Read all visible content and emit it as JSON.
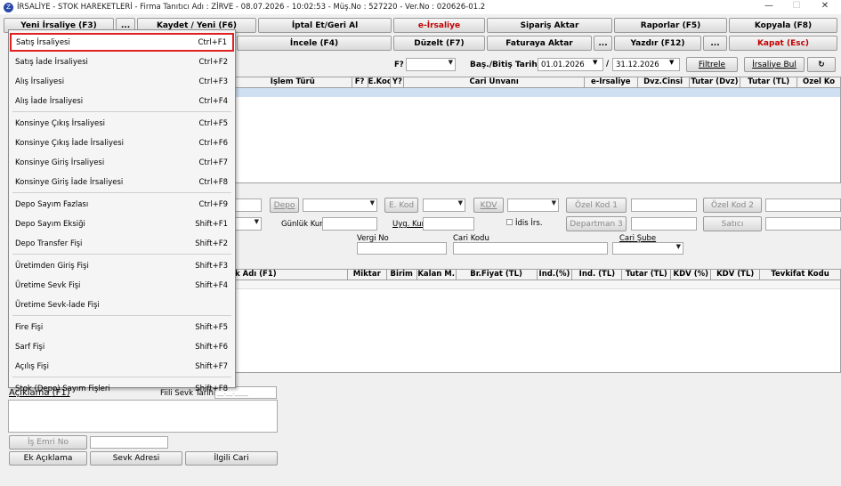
{
  "window": {
    "title": "İRSALİYE - STOK HAREKETLERİ - Firma Tanıtıcı Adı : ZİRVE - 08.07.2026 - 10:02:53 - Müş.No : 527220 - Ver.No : 020626-01.2",
    "minimize": "—",
    "maximize": "☐",
    "close": "✕"
  },
  "toolbar": {
    "row1": [
      "Yeni İrsaliye (F3)",
      "...",
      "Kaydet / Yeni (F6)",
      "İptal Et/Geri Al",
      "e-İrsaliye",
      "Sipariş Aktar",
      "Raporlar (F5)",
      "Kopyala (F8)"
    ],
    "row2": [
      "İncele (F4)",
      "Düzelt (F7)",
      "Faturaya Aktar",
      "...",
      "Yazdır (F12)",
      "...",
      "Kapat (Esc)"
    ]
  },
  "filter": {
    "f_label": "F?",
    "date_label": "Baş./Bitiş Tarihi",
    "start_date": "01.01.2026",
    "slash": "/",
    "end_date": "31.12.2026",
    "filter_button": "Filtrele",
    "find_button": "İrsaliye Bul",
    "refresh_icon": "↻"
  },
  "top_grid": {
    "columns": [
      "İşlem Türü",
      "F?",
      "E.Kod",
      "Y?",
      "Cari Unvanı",
      "e-İrsaliye",
      "Dvz.Cinsi",
      "Tutar (Dvz)",
      "Tutar (TL)",
      "Özel Ko"
    ]
  },
  "form": {
    "depo": "Depo",
    "e_kod": "E. Kod",
    "kdv": "KDV",
    "ozel_kod_1": "Özel Kod 1",
    "ozel_kod_2": "Özel Kod 2",
    "gunluk_kur": "Günlük Kur",
    "uyg_kur": "Uyg. Kur",
    "idis_irs": "İdis İrs.",
    "departman_3": "Departman 3",
    "satici": "Satıcı",
    "vergi_no": "Vergi No",
    "cari_kodu": "Cari Kodu",
    "cari_sube": "Cari Şube"
  },
  "item_grid": {
    "columns": [
      "k Adı (F1)",
      "Miktar",
      "Birim",
      "Kalan M.",
      "Br.Fiyat (TL)",
      "İnd.(%)",
      "İnd. (TL)",
      "Tutar (TL)",
      "KDV (%)",
      "KDV (TL)",
      "Tevkifat Kodu"
    ]
  },
  "bottom": {
    "aciklama": "Açıklama (F1)",
    "fiili_sevk": "Fiili Sevk Tarihi",
    "fiili_sevk_value": "__.__.____",
    "is_emri": "İş Emri No",
    "ek_aciklama": "Ek Açıklama",
    "sevk_adresi": "Sevk Adresi",
    "ilgili_cari": "İlgili Cari"
  },
  "menu": {
    "groups": [
      [
        {
          "label": "Satış İrsaliyesi",
          "shortcut": "Ctrl+F1"
        },
        {
          "label": "Satış İade İrsaliyesi",
          "shortcut": "Ctrl+F2"
        },
        {
          "label": "Alış İrsaliyesi",
          "shortcut": "Ctrl+F3"
        },
        {
          "label": "Alış İade İrsaliyesi",
          "shortcut": "Ctrl+F4"
        }
      ],
      [
        {
          "label": "Konsinye Çıkış İrsaliyesi",
          "shortcut": "Ctrl+F5"
        },
        {
          "label": "Konsinye Çıkış İade İrsaliyesi",
          "shortcut": "Ctrl+F6"
        },
        {
          "label": "Konsinye Giriş İrsaliyesi",
          "shortcut": "Ctrl+F7"
        },
        {
          "label": "Konsinye Giriş İade İrsaliyesi",
          "shortcut": "Ctrl+F8"
        }
      ],
      [
        {
          "label": "Depo Sayım Fazlası",
          "shortcut": "Ctrl+F9"
        },
        {
          "label": "Depo Sayım Eksiği",
          "shortcut": "Shift+F1"
        },
        {
          "label": "Depo Transfer Fişi",
          "shortcut": "Shift+F2"
        }
      ],
      [
        {
          "label": "Üretimden Giriş Fişi",
          "shortcut": "Shift+F3"
        },
        {
          "label": "Üretime Sevk Fişi",
          "shortcut": "Shift+F4"
        },
        {
          "label": "Üretime Sevk-İade Fişi",
          "shortcut": ""
        }
      ],
      [
        {
          "label": "Fire Fişi",
          "shortcut": "Shift+F5"
        },
        {
          "label": "Sarf Fişi",
          "shortcut": "Shift+F6"
        },
        {
          "label": "Açılış Fişi",
          "shortcut": "Shift+F7"
        }
      ],
      [
        {
          "label": "Stok (Depo) Sayım Fişleri",
          "shortcut": "Shift+F8"
        }
      ]
    ]
  },
  "colors": {
    "accent_red": "#c00000",
    "selection_outline": "#e12020",
    "row_highlight": "#cfe0f3"
  }
}
